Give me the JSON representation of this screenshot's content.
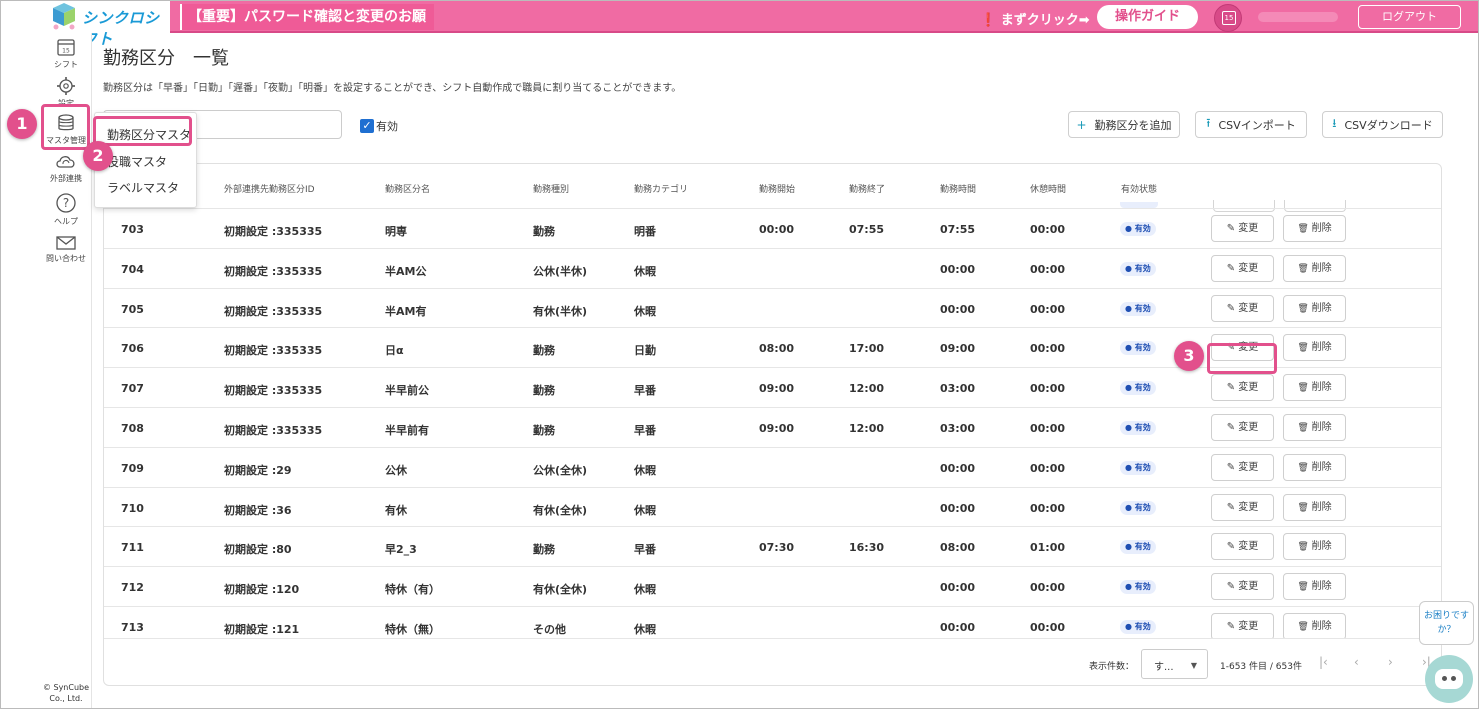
{
  "app": {
    "logo_text": "シンクロシフト"
  },
  "header": {
    "notice": "【重要】パスワード確認と変更のお願い",
    "click_first": "❗ まずクリック➡",
    "guide_button": "操作ガイド",
    "calendar_day": "15",
    "logout_button": "ログアウト"
  },
  "sidebar": {
    "items": [
      {
        "label": "シフト",
        "icon": "calendar-icon",
        "day": "15"
      },
      {
        "label": "設定",
        "icon": "gear-icon"
      },
      {
        "label": "マスタ管理",
        "icon": "database-icon"
      },
      {
        "label": "外部連携",
        "icon": "cloud-sync-icon"
      },
      {
        "label": "ヘルプ",
        "icon": "help-icon"
      },
      {
        "label": "問い合わせ",
        "icon": "mail-icon"
      }
    ],
    "copyright": "© SynCube Co., Ltd."
  },
  "dropdown": {
    "items": [
      "勤務区分マスタ",
      "役職マスタ",
      "ラベルマスタ"
    ]
  },
  "steps": [
    "1",
    "2",
    "3"
  ],
  "main": {
    "title": "勤務区分　一覧",
    "description": "勤務区分は「早番」「日勤」「遅番」「夜勤」「明番」を設定することができ、シフト自動作成で職員に割り当てることができます。",
    "filter_valid_label": "有効",
    "add_button": "勤務区分を追加",
    "import_button": "CSVインポート",
    "download_button": "CSVダウンロード"
  },
  "table": {
    "headers": [
      "外部連携先勤務区分ID",
      "勤務区分名",
      "勤務種別",
      "勤務カテゴリ",
      "勤務開始",
      "勤務終了",
      "勤務時間",
      "休憩時間",
      "有効状態"
    ],
    "edit_label": "変更",
    "delete_label": "削除",
    "rows": [
      {
        "id": "703",
        "ext_id": "初期設定 :335335",
        "name": "明専",
        "type": "勤務",
        "category": "明番",
        "start": "00:00",
        "end": "07:55",
        "hours": "07:55",
        "break": "00:00",
        "status": "● 有効"
      },
      {
        "id": "704",
        "ext_id": "初期設定 :335335",
        "name": "半AM公",
        "type": "公休(半休)",
        "category": "休暇",
        "start": "",
        "end": "",
        "hours": "00:00",
        "break": "00:00",
        "status": "● 有効"
      },
      {
        "id": "705",
        "ext_id": "初期設定 :335335",
        "name": "半AM有",
        "type": "有休(半休)",
        "category": "休暇",
        "start": "",
        "end": "",
        "hours": "00:00",
        "break": "00:00",
        "status": "● 有効"
      },
      {
        "id": "706",
        "ext_id": "初期設定 :335335",
        "name": "日α",
        "type": "勤務",
        "category": "日勤",
        "start": "08:00",
        "end": "17:00",
        "hours": "09:00",
        "break": "00:00",
        "status": "● 有効"
      },
      {
        "id": "707",
        "ext_id": "初期設定 :335335",
        "name": "半早前公",
        "type": "勤務",
        "category": "早番",
        "start": "09:00",
        "end": "12:00",
        "hours": "03:00",
        "break": "00:00",
        "status": "● 有効"
      },
      {
        "id": "708",
        "ext_id": "初期設定 :335335",
        "name": "半早前有",
        "type": "勤務",
        "category": "早番",
        "start": "09:00",
        "end": "12:00",
        "hours": "03:00",
        "break": "00:00",
        "status": "● 有効"
      },
      {
        "id": "709",
        "ext_id": "初期設定 :29",
        "name": "公休",
        "type": "公休(全休)",
        "category": "休暇",
        "start": "",
        "end": "",
        "hours": "00:00",
        "break": "00:00",
        "status": "● 有効"
      },
      {
        "id": "710",
        "ext_id": "初期設定 :36",
        "name": "有休",
        "type": "有休(全休)",
        "category": "休暇",
        "start": "",
        "end": "",
        "hours": "00:00",
        "break": "00:00",
        "status": "● 有効"
      },
      {
        "id": "711",
        "ext_id": "初期設定 :80",
        "name": "早2_3",
        "type": "勤務",
        "category": "早番",
        "start": "07:30",
        "end": "16:30",
        "hours": "08:00",
        "break": "01:00",
        "status": "● 有効"
      },
      {
        "id": "712",
        "ext_id": "初期設定 :120",
        "name": "特休（有）",
        "type": "有休(全休)",
        "category": "休暇",
        "start": "",
        "end": "",
        "hours": "00:00",
        "break": "00:00",
        "status": "● 有効"
      },
      {
        "id": "713",
        "ext_id": "初期設定 :121",
        "name": "特休（無）",
        "type": "その他",
        "category": "休暇",
        "start": "",
        "end": "",
        "hours": "00:00",
        "break": "00:00",
        "status": "● 有効"
      }
    ]
  },
  "footer": {
    "per_page_label": "表示件数：",
    "per_page_value": "す...",
    "range": "1-653 件目 / 653件"
  },
  "help": {
    "bubble": "お困りですか？"
  },
  "colors": {
    "accent_pink": "#f06ba3",
    "highlight": "#e2508c",
    "link_blue": "#1a9ad6",
    "valid_badge": "#1f4fb3"
  }
}
